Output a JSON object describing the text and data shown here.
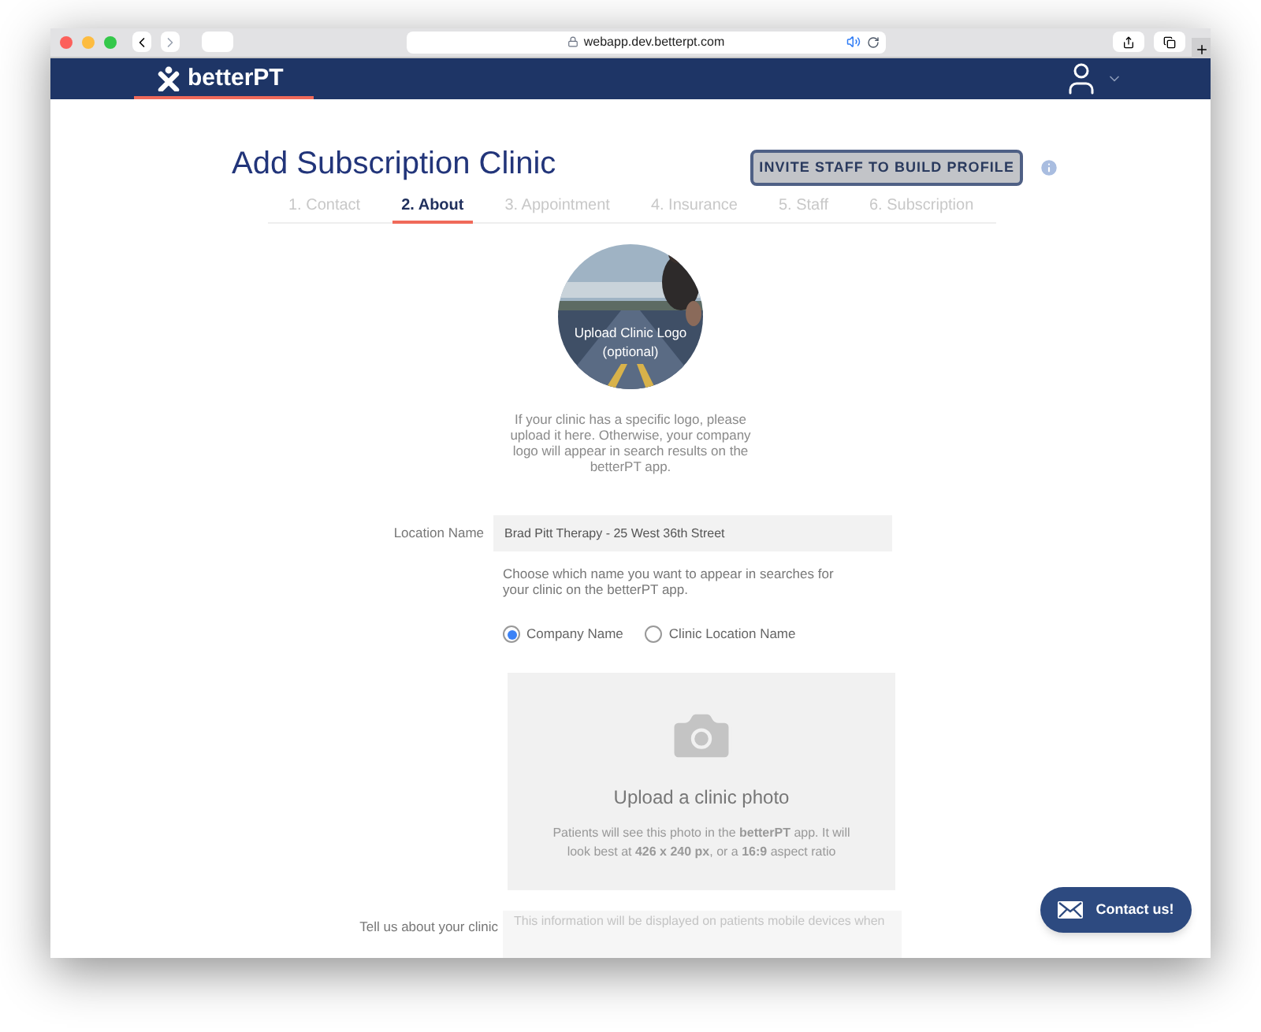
{
  "browser": {
    "url": "webapp.dev.betterpt.com"
  },
  "navbar": {
    "brand": "betterPT"
  },
  "page": {
    "title": "Add Subscription Clinic",
    "invite_button": "INVITE STAFF TO BUILD PROFILE"
  },
  "steps": [
    {
      "label": "1. Contact",
      "selected": false
    },
    {
      "label": "2. About",
      "selected": true
    },
    {
      "label": "3. Appointment",
      "selected": false
    },
    {
      "label": "4. Insurance",
      "selected": false
    },
    {
      "label": "5. Staff",
      "selected": false
    },
    {
      "label": "6. Subscription",
      "selected": false
    }
  ],
  "logo_upload": {
    "kind": "picture",
    "label": "Upload Clinic Logo",
    "note": "(optional)",
    "help": "If your clinic has a specific logo, please upload it here. Otherwise, your company logo will appear in search results on the betterPT app."
  },
  "location_name": {
    "label": "Location Name",
    "value": "Brad Pitt Therapy - 25 West 36th Street",
    "help": "Choose which name you want to appear in searches for your clinic on the betterPT app."
  },
  "name_options": [
    {
      "label": "Company Name",
      "selected": true
    },
    {
      "label": "Clinic Location Name",
      "selected": false
    }
  ],
  "photo_upload": {
    "title": "Upload a clinic photo",
    "help": "Patients will see this photo in the **betterPT** app. It will look best at **426 x 240 px**, or a **16:9** aspect ratio"
  },
  "about": {
    "label": "Tell us about your clinic",
    "placeholder": "This information will be displayed on patients mobile devices when"
  },
  "contact_button": "Contact us!"
}
